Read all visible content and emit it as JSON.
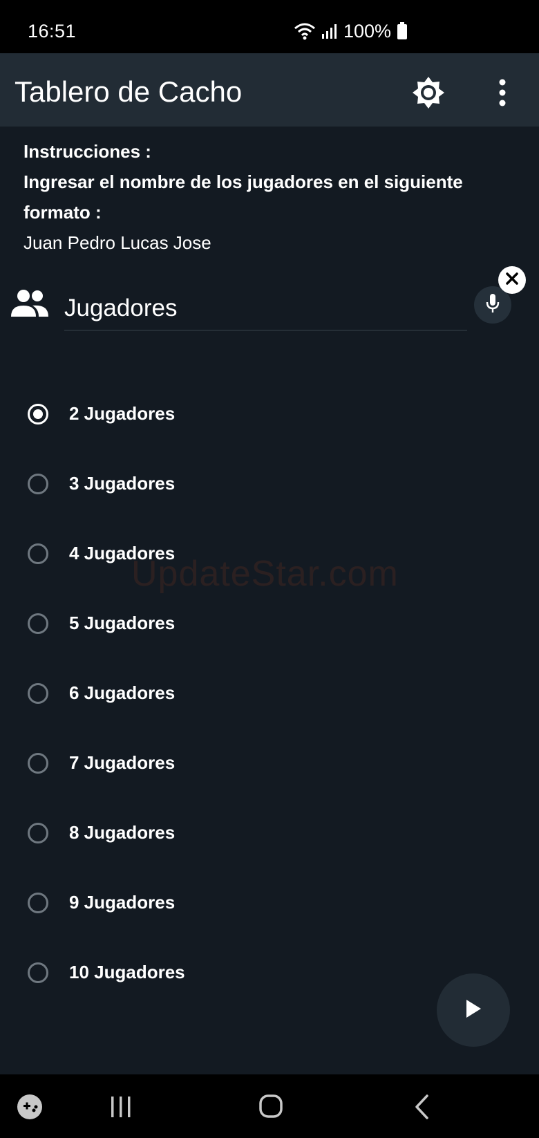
{
  "status_bar": {
    "time": "16:51",
    "battery": "100%",
    "icons": [
      "wifi-icon",
      "signal-icon",
      "battery-icon"
    ]
  },
  "app_bar": {
    "title": "Tablero de Cacho",
    "actions": [
      "brightness-icon",
      "more-vert-icon"
    ]
  },
  "instructions": {
    "heading": "Instrucciones :",
    "line1": "Ingresar el nombre de los jugadores en el siguiente formato :",
    "example": "Juan Pedro Lucas Jose"
  },
  "players_field": {
    "icon": "people-icon",
    "placeholder": "Jugadores",
    "value": ""
  },
  "radio_options": [
    {
      "label": "2 Jugadores",
      "selected": true
    },
    {
      "label": "3 Jugadores",
      "selected": false
    },
    {
      "label": "4 Jugadores",
      "selected": false
    },
    {
      "label": "5 Jugadores",
      "selected": false
    },
    {
      "label": "6 Jugadores",
      "selected": false
    },
    {
      "label": "7 Jugadores",
      "selected": false
    },
    {
      "label": "8 Jugadores",
      "selected": false
    },
    {
      "label": "9 Jugadores",
      "selected": false
    },
    {
      "label": "10 Jugadores",
      "selected": false
    }
  ],
  "watermark": "UpdateStar.com",
  "fab": {
    "icon": "play-icon"
  },
  "nav_bar": {
    "icons": [
      "game-icon",
      "recents-icon",
      "home-icon",
      "back-icon"
    ]
  },
  "colors": {
    "background": "#131a22",
    "app_bar": "#222c35",
    "system_bars": "#000000",
    "text": "#ffffff"
  }
}
